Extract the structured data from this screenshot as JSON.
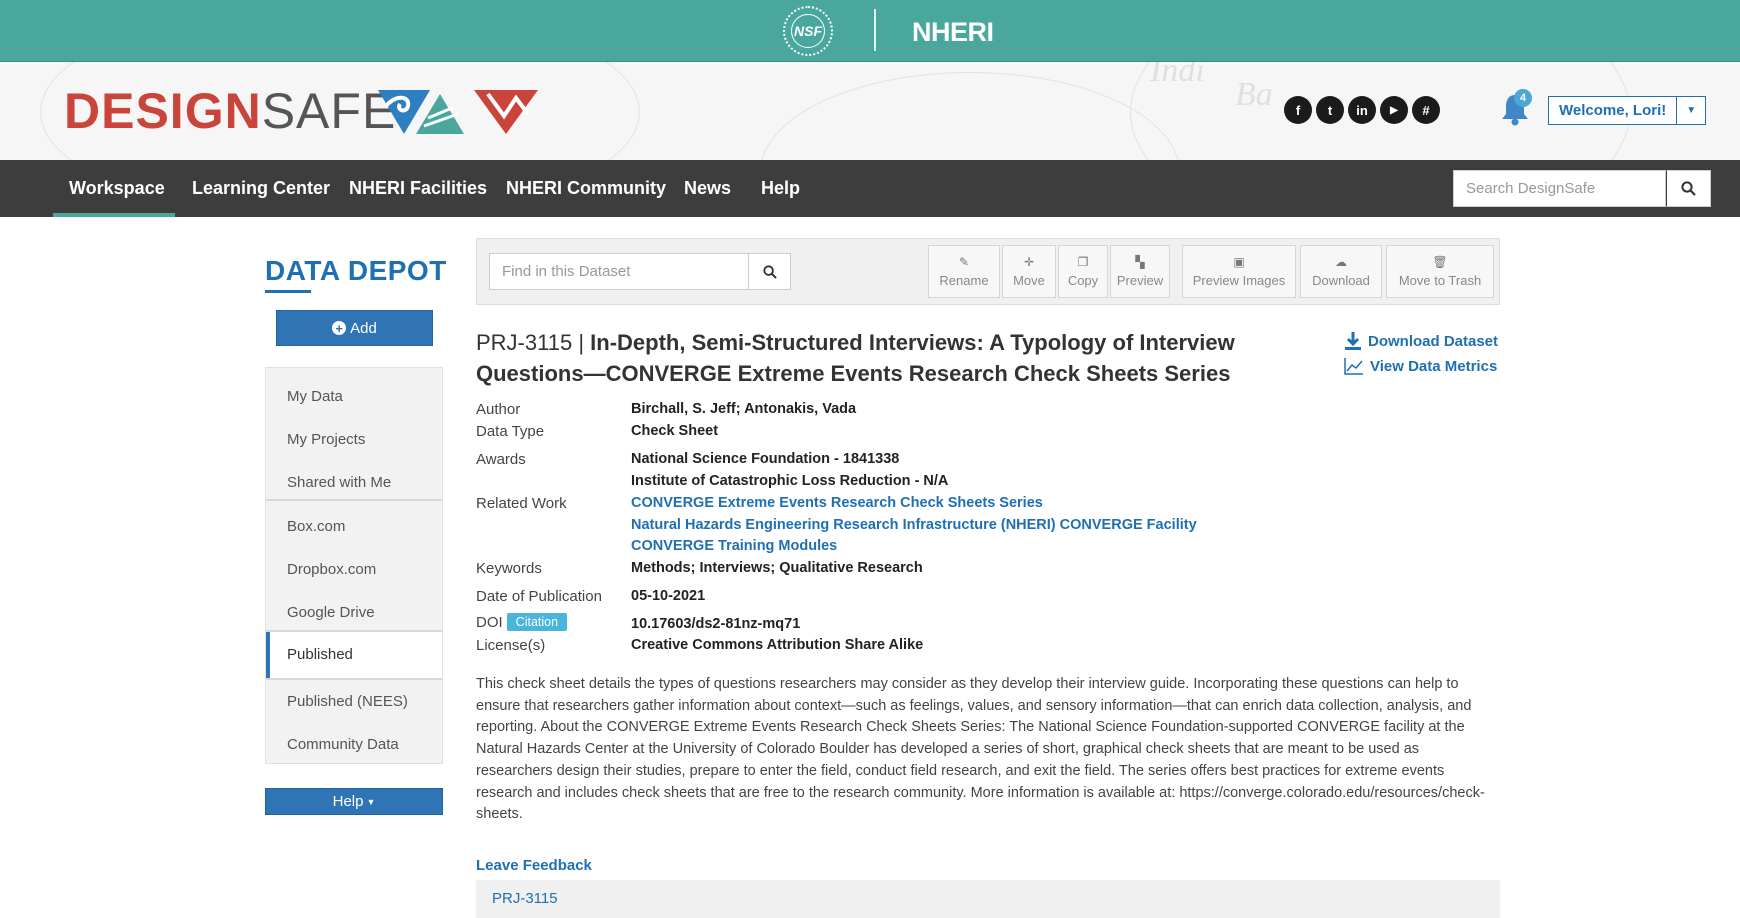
{
  "topbar": {
    "nsf_seal": "NSF",
    "nheri": "NHERI"
  },
  "brand": {
    "design": "DESIGN",
    "safe": "SAFE"
  },
  "social": [
    {
      "name": "facebook-icon",
      "glyph": "f"
    },
    {
      "name": "twitter-icon",
      "glyph": "t"
    },
    {
      "name": "linkedin-icon",
      "glyph": "in"
    },
    {
      "name": "youtube-icon",
      "glyph": "▶"
    },
    {
      "name": "slack-icon",
      "glyph": "#"
    }
  ],
  "notifications": {
    "count": "4"
  },
  "user": {
    "welcome": "Welcome, Lori!"
  },
  "nav": {
    "items": [
      "Workspace",
      "Learning Center",
      "NHERI Facilities",
      "NHERI Community",
      "News",
      "Help"
    ],
    "active": "Workspace",
    "search_placeholder": "Search DesignSafe"
  },
  "sidebar": {
    "title": "DATA DEPOT",
    "add_label": "Add",
    "items": [
      "My Data",
      "My Projects",
      "Shared with Me",
      "Box.com",
      "Dropbox.com",
      "Google Drive",
      "Published",
      "Published (NEES)",
      "Community Data"
    ],
    "active": "Published",
    "help_label": "Help"
  },
  "toolbar": {
    "find_placeholder": "Find in this Dataset",
    "buttons": [
      "Rename",
      "Move",
      "Copy",
      "Preview",
      "Preview Images",
      "Download",
      "Move to Trash"
    ]
  },
  "dataset": {
    "project_id": "PRJ-3115",
    "title": "In-Depth, Semi-Structured Interviews: A Typology of Interview Questions—CONVERGE Extreme Events Research Check Sheets Series",
    "download_label": "Download Dataset",
    "metrics_label": "View Data Metrics",
    "fields": {
      "author_label": "Author",
      "author": "Birchall, S. Jeff; Antonakis, Vada",
      "data_type_label": "Data Type",
      "data_type": "Check Sheet",
      "awards_label": "Awards",
      "awards": [
        "National Science Foundation - 1841338",
        "Institute of Catastrophic Loss Reduction - N/A"
      ],
      "related_work_label": "Related Work",
      "related_work": [
        "CONVERGE Extreme Events Research Check Sheets Series",
        "Natural Hazards Engineering Research Infrastructure (NHERI) CONVERGE Facility",
        "CONVERGE Training Modules"
      ],
      "keywords_label": "Keywords",
      "keywords": "Methods; Interviews; Qualitative Research",
      "date_label": "Date of Publication",
      "date": "05-10-2021",
      "doi_label": "DOI",
      "citation_label": "Citation",
      "doi": "10.17603/ds2-81nz-mq71",
      "license_label": "License(s)",
      "license": "Creative Commons Attribution Share Alike"
    },
    "description": "This check sheet details the types of questions researchers may consider as they develop their interview guide. Incorporating these questions can help to ensure that researchers gather information about context—such as feelings, values, and sensory information—that can enrich data collection, analysis, and reporting. About the CONVERGE Extreme Events Research Check Sheets Series: The National Science Foundation-supported CONVERGE facility at the Natural Hazards Center at the University of Colorado Boulder has developed a series of short, graphical check sheets that are meant to be used as researchers design their studies, prepare to enter the field, conduct field research, and exit the field. The series offers best practices for extreme events research and includes check sheets that are free to the research community. More information is available at: https://converge.colorado.edu/resources/check-sheets.",
    "feedback_label": "Leave Feedback",
    "footer_project": "PRJ-3115"
  }
}
